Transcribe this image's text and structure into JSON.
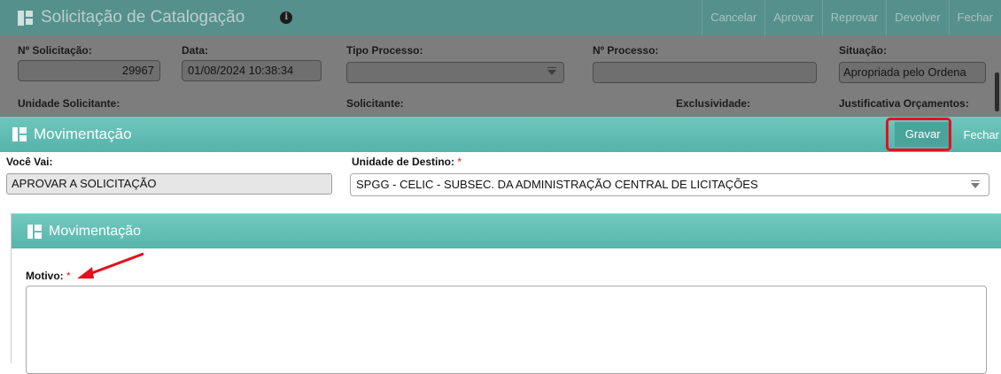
{
  "background_window": {
    "title": "Solicitação de Catalogação",
    "info_icon": "info-icon",
    "actions": [
      "Cancelar",
      "Aprovar",
      "Reprovar",
      "Devolver",
      "Fechar"
    ],
    "fields": {
      "numero_solicitacao_label": "Nº Solicitação:",
      "numero_solicitacao_value": "29967",
      "data_label": "Data:",
      "data_value": "01/08/2024 10:38:34",
      "tipo_processo_label": "Tipo Processo:",
      "tipo_processo_value": "",
      "numero_processo_label": "Nº Processo:",
      "numero_processo_value": "",
      "situacao_label": "Situação:",
      "situacao_value": "Apropriada pelo Ordena",
      "unidade_solicitante_label": "Unidade Solicitante:",
      "solicitante_label": "Solicitante:",
      "exclusividade_label": "Exclusividade:",
      "justificativa_label": "Justificativa Orçamentos:"
    }
  },
  "dialog": {
    "title": "Movimentação",
    "gravar_label": "Gravar",
    "fechar_label": "Fechar",
    "voce_vai_label": "Você Vai:",
    "voce_vai_value": "APROVAR A SOLICITAÇÃO",
    "unidade_destino_label": "Unidade de Destino:",
    "required_mark": "*",
    "unidade_destino_value": "SPGG - CELIC - SUBSEC. DA ADMINISTRAÇÃO CENTRAL DE LICITAÇÕES"
  },
  "inner_panel": {
    "title": "Movimentação",
    "motivo_label": "Motivo:",
    "required_mark": "*",
    "motivo_value": ""
  },
  "annotations": {
    "highlight_color": "#e3101d",
    "arrow_color": "#e3101d"
  },
  "colors": {
    "header_teal": "#5cb8ae",
    "dim_overlay": "#7d7d7d"
  }
}
